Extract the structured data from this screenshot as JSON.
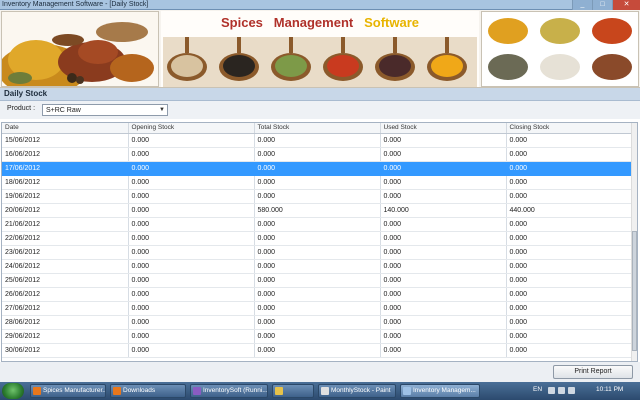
{
  "window": {
    "title": "Inventory Management Software - [Daily Stock]"
  },
  "banner": {
    "word1": "Spices",
    "word2": "Management",
    "word3": "Software"
  },
  "section": {
    "title": "Daily Stock"
  },
  "product": {
    "label": "Product :",
    "value": "S+RC Raw"
  },
  "table": {
    "columns": [
      "Date",
      "Opening Stock",
      "Total Stock",
      "Used Stock",
      "Closing Stock"
    ],
    "rows": [
      [
        "15/06/2012",
        "0.000",
        "0.000",
        "0.000",
        "0.000"
      ],
      [
        "16/06/2012",
        "0.000",
        "0.000",
        "0.000",
        "0.000"
      ],
      [
        "17/06/2012",
        "0.000",
        "0.000",
        "0.000",
        "0.000"
      ],
      [
        "18/06/2012",
        "0.000",
        "0.000",
        "0.000",
        "0.000"
      ],
      [
        "19/06/2012",
        "0.000",
        "0.000",
        "0.000",
        "0.000"
      ],
      [
        "20/06/2012",
        "0.000",
        "580.000",
        "140.000",
        "440.000"
      ],
      [
        "21/06/2012",
        "0.000",
        "0.000",
        "0.000",
        "0.000"
      ],
      [
        "22/06/2012",
        "0.000",
        "0.000",
        "0.000",
        "0.000"
      ],
      [
        "23/06/2012",
        "0.000",
        "0.000",
        "0.000",
        "0.000"
      ],
      [
        "24/06/2012",
        "0.000",
        "0.000",
        "0.000",
        "0.000"
      ],
      [
        "25/06/2012",
        "0.000",
        "0.000",
        "0.000",
        "0.000"
      ],
      [
        "26/06/2012",
        "0.000",
        "0.000",
        "0.000",
        "0.000"
      ],
      [
        "27/06/2012",
        "0.000",
        "0.000",
        "0.000",
        "0.000"
      ],
      [
        "28/06/2012",
        "0.000",
        "0.000",
        "0.000",
        "0.000"
      ],
      [
        "29/06/2012",
        "0.000",
        "0.000",
        "0.000",
        "0.000"
      ],
      [
        "30/06/2012",
        "0.000",
        "0.000",
        "0.000",
        "0.000"
      ]
    ],
    "selected_index": 2
  },
  "buttons": {
    "print": "Print Report"
  },
  "taskbar": {
    "items": [
      {
        "label": "Spices Manufacturer...",
        "icon": "firefox-icon"
      },
      {
        "label": "Downloads",
        "icon": "firefox-icon"
      },
      {
        "label": "InventorySoft (Runni...",
        "icon": "visual-studio-icon"
      },
      {
        "label": "",
        "icon": "folder-icon"
      },
      {
        "label": "MonthlyStock - Paint",
        "icon": "paint-icon"
      },
      {
        "label": "Inventory Managem...",
        "icon": "app-window-icon",
        "active": true
      }
    ],
    "lang": "EN",
    "time": "10:11 PM"
  },
  "colors": {
    "selection": "#3399ff",
    "brand_red": "#b0312a",
    "brand_yellow": "#e8b400"
  }
}
